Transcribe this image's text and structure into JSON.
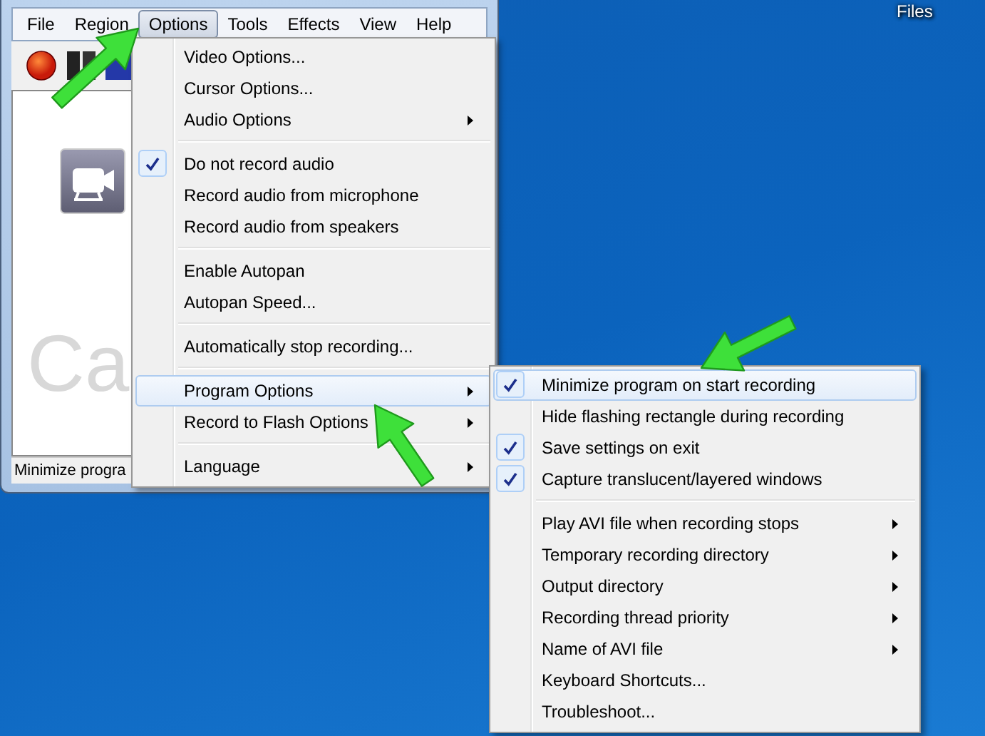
{
  "desktop": {
    "icon_label": "Files"
  },
  "window": {
    "menu_bar": [
      {
        "label": "File",
        "selected": false
      },
      {
        "label": "Region",
        "selected": false
      },
      {
        "label": "Options",
        "selected": true
      },
      {
        "label": "Tools",
        "selected": false
      },
      {
        "label": "Effects",
        "selected": false
      },
      {
        "label": "View",
        "selected": false
      },
      {
        "label": "Help",
        "selected": false
      }
    ],
    "canvas_text": "Ca",
    "status_bar": "Minimize progra"
  },
  "options_menu": {
    "sections": [
      [
        {
          "label": "Video Options...",
          "checked": false,
          "has_submenu": false,
          "selected": false
        },
        {
          "label": "Cursor Options...",
          "checked": false,
          "has_submenu": false,
          "selected": false
        },
        {
          "label": "Audio Options",
          "checked": false,
          "has_submenu": true,
          "selected": false
        }
      ],
      [
        {
          "label": "Do not record audio",
          "checked": true,
          "has_submenu": false,
          "selected": false
        },
        {
          "label": "Record audio from microphone",
          "checked": false,
          "has_submenu": false,
          "selected": false
        },
        {
          "label": "Record audio from speakers",
          "checked": false,
          "has_submenu": false,
          "selected": false
        }
      ],
      [
        {
          "label": "Enable Autopan",
          "checked": false,
          "has_submenu": false,
          "selected": false
        },
        {
          "label": "Autopan Speed...",
          "checked": false,
          "has_submenu": false,
          "selected": false
        }
      ],
      [
        {
          "label": "Automatically stop recording...",
          "checked": false,
          "has_submenu": false,
          "selected": false
        }
      ],
      [
        {
          "label": "Program Options",
          "checked": false,
          "has_submenu": true,
          "selected": true
        },
        {
          "label": "Record to Flash Options",
          "checked": false,
          "has_submenu": true,
          "selected": false
        }
      ],
      [
        {
          "label": "Language",
          "checked": false,
          "has_submenu": true,
          "selected": false
        }
      ]
    ]
  },
  "program_options_menu": {
    "sections": [
      [
        {
          "label": "Minimize program on start recording",
          "checked": true,
          "has_submenu": false,
          "selected": true
        },
        {
          "label": "Hide flashing rectangle during recording",
          "checked": false,
          "has_submenu": false,
          "selected": false
        },
        {
          "label": "Save settings on exit",
          "checked": true,
          "has_submenu": false,
          "selected": false
        },
        {
          "label": "Capture translucent/layered windows",
          "checked": true,
          "has_submenu": false,
          "selected": false
        }
      ],
      [
        {
          "label": "Play AVI file when recording stops",
          "checked": false,
          "has_submenu": true,
          "selected": false
        },
        {
          "label": "Temporary recording directory",
          "checked": false,
          "has_submenu": true,
          "selected": false
        },
        {
          "label": "Output directory",
          "checked": false,
          "has_submenu": true,
          "selected": false
        },
        {
          "label": "Recording thread priority",
          "checked": false,
          "has_submenu": true,
          "selected": false
        },
        {
          "label": "Name of AVI file",
          "checked": false,
          "has_submenu": true,
          "selected": false
        },
        {
          "label": "Keyboard Shortcuts...",
          "checked": false,
          "has_submenu": false,
          "selected": false
        },
        {
          "label": "Troubleshoot...",
          "checked": false,
          "has_submenu": false,
          "selected": false
        }
      ]
    ]
  }
}
